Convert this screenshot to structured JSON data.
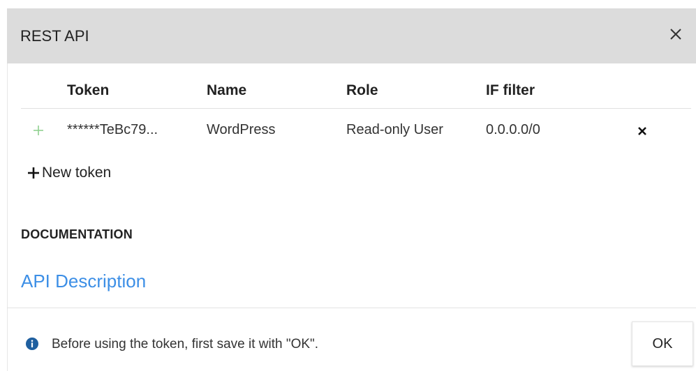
{
  "dialog": {
    "title": "REST API",
    "close_icon": "close-icon"
  },
  "table": {
    "columns": [
      "Token",
      "Name",
      "Role",
      "IF filter"
    ],
    "rows": [
      {
        "expand_icon": "plus-icon",
        "token": "******TeBc79...",
        "name": "WordPress",
        "role": "Read-only User",
        "filter": "0.0.0.0/0",
        "delete_icon": "close-icon"
      }
    ]
  },
  "new_token": {
    "icon": "plus-icon",
    "label": "New token"
  },
  "documentation": {
    "heading": "DOCUMENTATION",
    "link_label": "API Description"
  },
  "footer": {
    "info_icon": "info-icon",
    "message": "Before using the token, first save it with \"OK\".",
    "ok_label": "OK"
  },
  "colors": {
    "header_bg": "#dcdcdc",
    "link": "#3d8fe6",
    "expand_plus": "#8fd18f",
    "info_icon": "#1f5f9f"
  }
}
